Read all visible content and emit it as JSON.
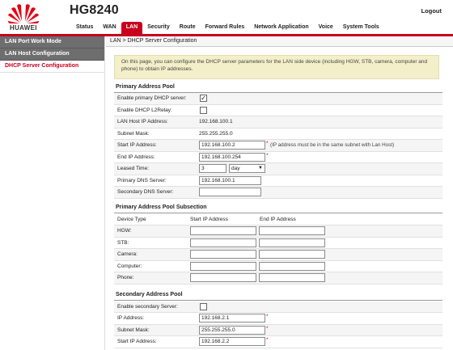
{
  "header": {
    "brand": "HUAWEI",
    "model": "HG8240",
    "logout": "Logout",
    "tabs": [
      "Status",
      "WAN",
      "LAN",
      "Security",
      "Route",
      "Forward Rules",
      "Network Application",
      "Voice",
      "System Tools"
    ],
    "active_tab": "LAN"
  },
  "sidebar": {
    "items": [
      "LAN Port Work Mode",
      "LAN Host Configuration",
      "DHCP Server Configuration"
    ],
    "active": "DHCP Server Configuration"
  },
  "breadcrumb": "LAN > DHCP Server Configuration",
  "info": "On this page, you can configure the DHCP server parameters for the LAN side device (including HGW, STB, camera, computer and phone) to obtain IP addresses.",
  "primary_pool": {
    "title": "Primary Address Pool",
    "enable_dhcp_label": "Enable primary DHCP server:",
    "enable_dhcp_checked": true,
    "enable_l2relay_label": "Enable DHCP L2Relay:",
    "enable_l2relay_checked": false,
    "lan_host_ip_label": "LAN Host IP Address:",
    "lan_host_ip": "192.168.100.1",
    "subnet_mask_label": "Subnet Mask:",
    "subnet_mask": "255.255.255.0",
    "start_ip_label": "Start IP Address:",
    "start_ip": "192.168.100.2",
    "start_ip_hint": "(IP address must be in the same subnet with Lan Host)",
    "end_ip_label": "End IP Address:",
    "end_ip": "192.168.100.254",
    "lease_label": "Leased Time:",
    "lease_value": "3",
    "lease_unit": "day",
    "primary_dns_label": "Primary DNS Server:",
    "primary_dns": "192.168.100.1",
    "secondary_dns_label": "Secondary DNS Server:",
    "secondary_dns": ""
  },
  "subsection": {
    "title": "Primary Address Pool Subsection",
    "col_device": "Device Type",
    "col_start": "Start IP Address",
    "col_end": "End IP Address",
    "rows": [
      "HGW:",
      "STB:",
      "Camera:",
      "Computer:",
      "Phone:"
    ]
  },
  "secondary_pool": {
    "title": "Secondary Address Pool",
    "enable_label": "Enable secondary Server:",
    "enable_checked": false,
    "ip_label": "IP Address:",
    "ip": "192.168.2.1",
    "mask_label": "Subnet Mask:",
    "mask": "255.255.255.0",
    "start_label": "Start IP Address:",
    "start": "192.168.2.2"
  },
  "colors": {
    "accent": "#c8001e",
    "sidebar": "#6e6e6e",
    "info_bg": "#f3efc9"
  }
}
